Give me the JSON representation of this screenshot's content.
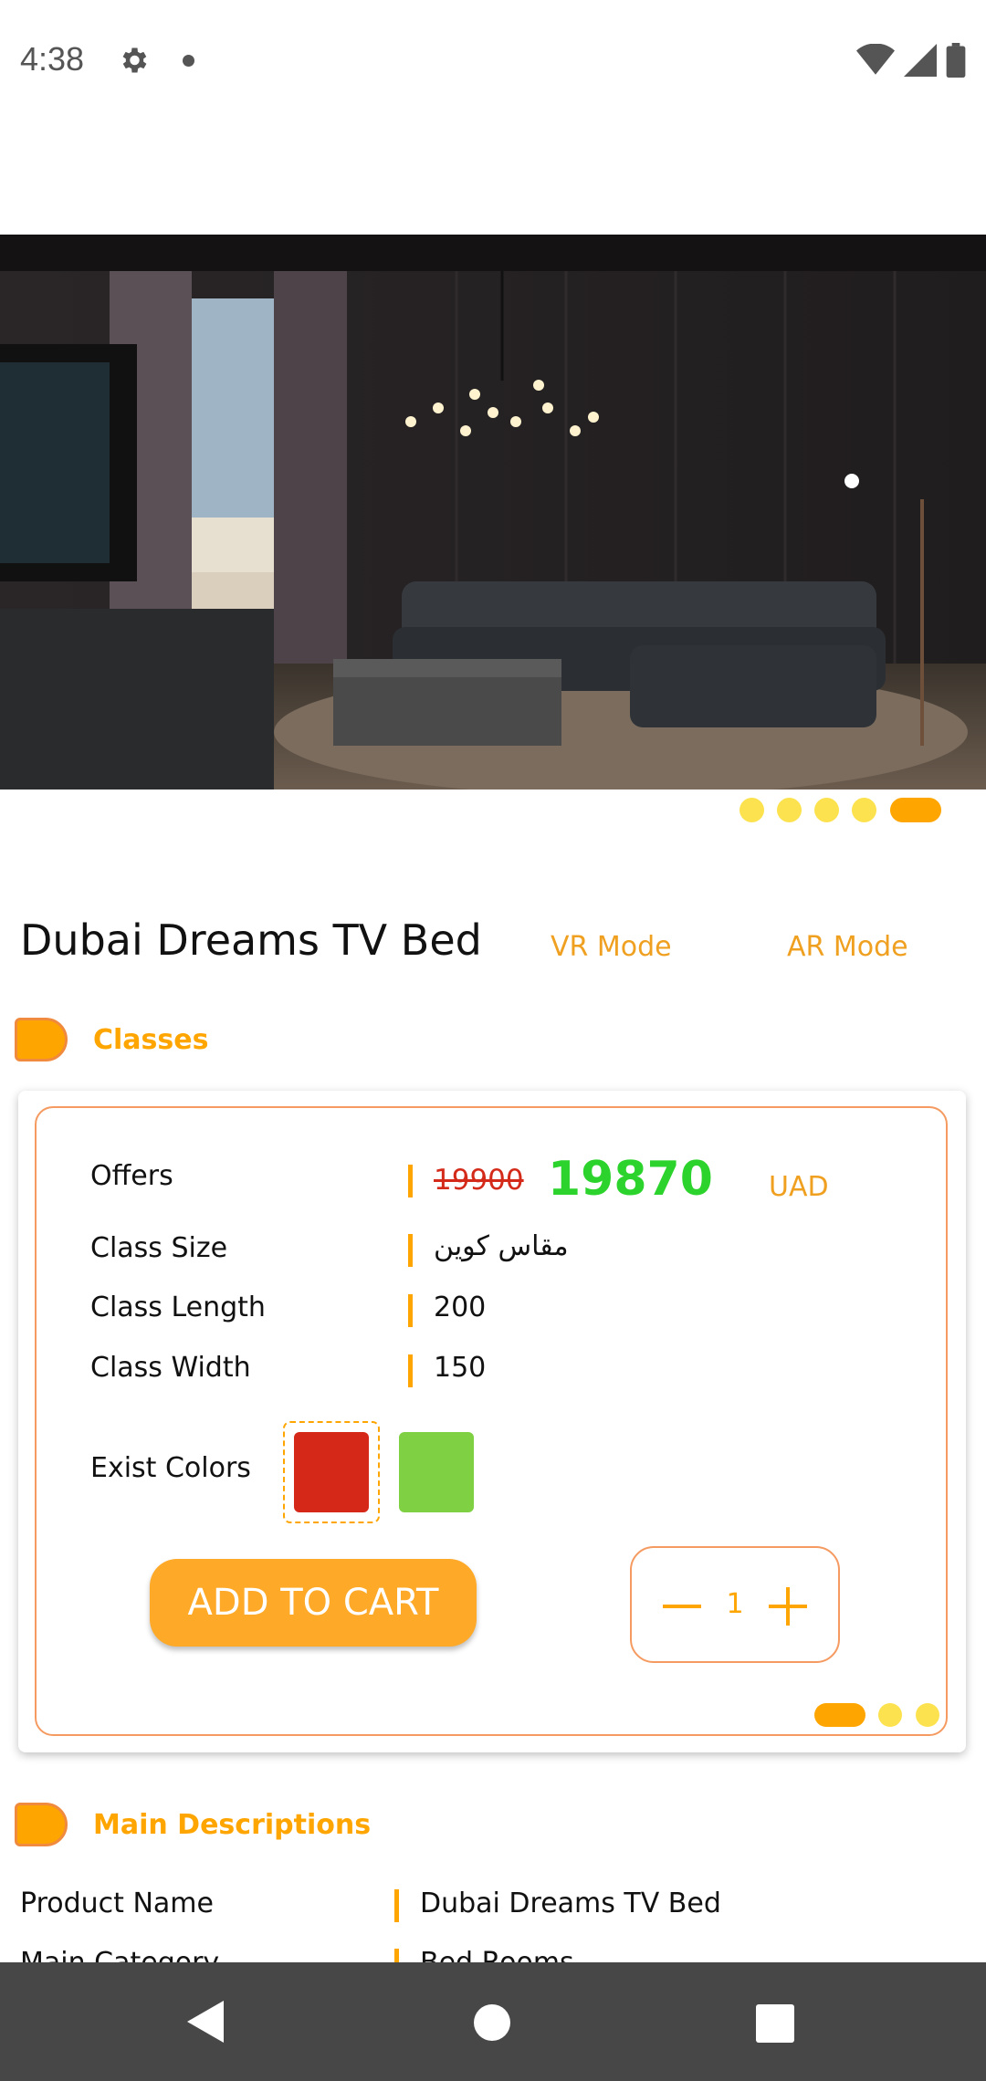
{
  "status_bar": {
    "time": "4:38"
  },
  "product": {
    "title": "Dubai Dreams TV Bed",
    "vr_mode": "VR Mode",
    "ar_mode": "AR Mode",
    "image_dots_total": 5,
    "image_dots_active": 5
  },
  "classes_section": {
    "title": "Classes",
    "offers_label": "Offers",
    "old_price": "19900",
    "new_price": "19870",
    "currency": "UAD",
    "class_size_label": "Class Size",
    "class_size_value": "مقاس كوين",
    "class_length_label": "Class Length",
    "class_length_value": "200",
    "class_width_label": "Class Width",
    "class_width_value": "150",
    "colors_label": "Exist Colors",
    "colors": [
      "#d52819",
      "#7fd143"
    ],
    "selected_color_index": 0,
    "add_to_cart": "ADD TO CART",
    "quantity": "1",
    "class_dots_total": 3,
    "class_dots_active": 1
  },
  "descriptions_section": {
    "title": "Main Descriptions",
    "product_name_label": "Product Name",
    "product_name_value": "Dubai Dreams TV Bed",
    "main_category_label": "Main Category",
    "main_category_value": "Bed Rooms"
  },
  "accent_color": "#ffa500"
}
